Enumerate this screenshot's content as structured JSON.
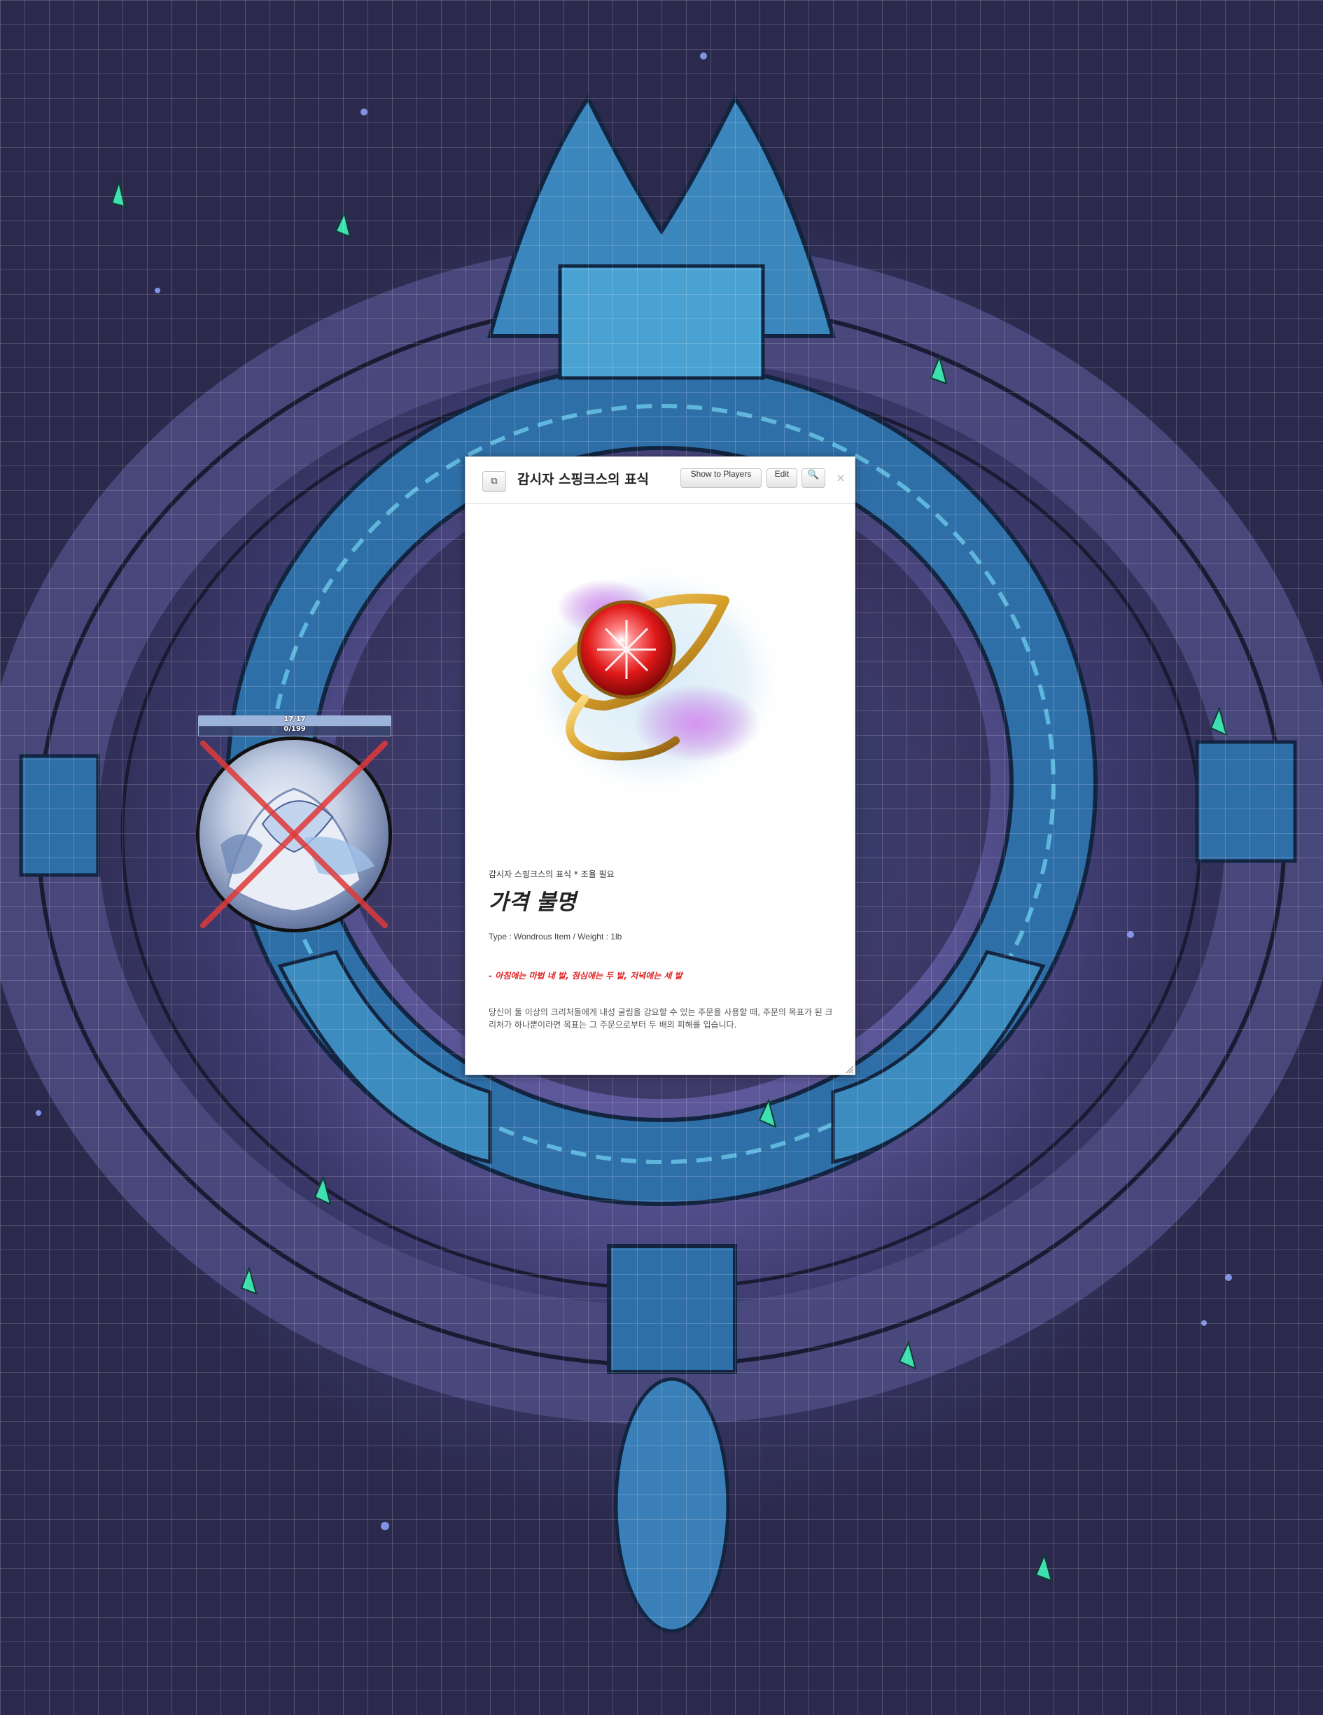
{
  "map": {
    "icons": [
      "ruined-portal-battlemap",
      "crystal-cluster-icons"
    ]
  },
  "token": {
    "bar1": {
      "text": "17/17",
      "fraction": 1.0
    },
    "bar2": {
      "text": "0/199",
      "fraction": 0.0
    },
    "status_marker": "red-x-dead",
    "colors": {
      "bar": "#9cb4dc",
      "x_marker": "#e03a3a"
    }
  },
  "dialog": {
    "title": "감시자 스핑크스의 표식",
    "popout_icon": "⧉",
    "buttons": {
      "show_to_players": "Show to Players",
      "edit": "Edit",
      "search_icon": "🔍"
    },
    "close_glyph": "×",
    "item": {
      "image_icon": "red-eye-gem-icon",
      "subtitle": "감시자 스핑크스의 표식 * 조율 필요",
      "price": "가격 불명",
      "type_weight": "Type : Wondrous Item / Weight : 1lb",
      "charges": "- 아침에는 마법 네 발, 점심에는 두 발, 저녁에는 세 발",
      "description": "당신이 둘 이상의 크리처들에게 내성 굴림을 강요할 수 있는 주문을 사용할 때, 주문의 목표가 된 크리처가 하나뿐이라면 목표는 그 주문으로부터 두 배의 피해를 입습니다."
    },
    "colors": {
      "charges": "#e02020",
      "title": "#222222"
    }
  }
}
